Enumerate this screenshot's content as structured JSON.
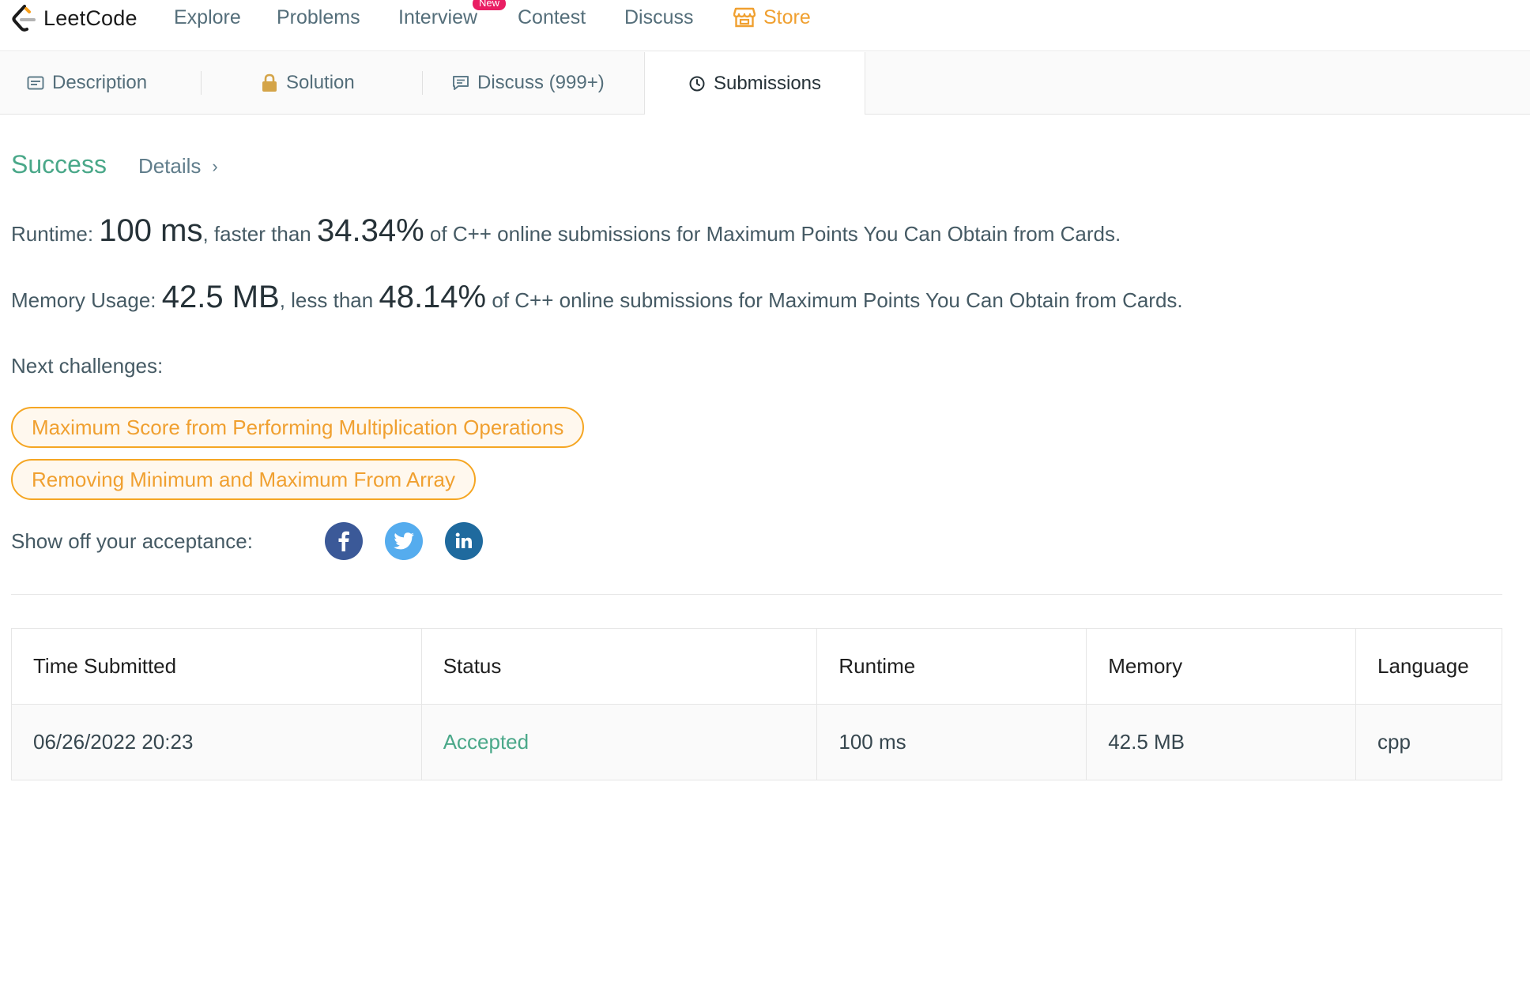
{
  "nav": {
    "logo_text": "LeetCode",
    "items": [
      "Explore",
      "Problems",
      "Interview",
      "Contest",
      "Discuss"
    ],
    "new_badge": "New",
    "store_label": "Store"
  },
  "tabs": {
    "description": "Description",
    "solution": "Solution",
    "discuss": "Discuss (999+)",
    "submissions": "Submissions"
  },
  "result": {
    "status": "Success",
    "details_label": "Details",
    "runtime": {
      "label": "Runtime:",
      "value": "100 ms",
      "mid": ", faster than",
      "percent": "34.34%",
      "suffix": "of C++ online submissions for Maximum Points You Can Obtain from Cards."
    },
    "memory": {
      "label": "Memory Usage:",
      "value": "42.5 MB",
      "mid": ", less than",
      "percent": "48.14%",
      "suffix": "of C++ online submissions for Maximum Points You Can Obtain from Cards."
    },
    "next_label": "Next challenges:",
    "challenges": [
      "Maximum Score from Performing Multiplication Operations",
      "Removing Minimum and Maximum From Array"
    ],
    "share_label": "Show off your acceptance:"
  },
  "colors": {
    "success": "#4aa889",
    "accent": "#f0a030",
    "facebook": "#3b5998",
    "twitter": "#55acee",
    "linkedin": "#1f6a9e"
  },
  "table": {
    "headers": [
      "Time Submitted",
      "Status",
      "Runtime",
      "Memory",
      "Language"
    ],
    "rows": [
      [
        "06/26/2022 20:23",
        "Accepted",
        "100 ms",
        "42.5 MB",
        "cpp"
      ]
    ]
  }
}
